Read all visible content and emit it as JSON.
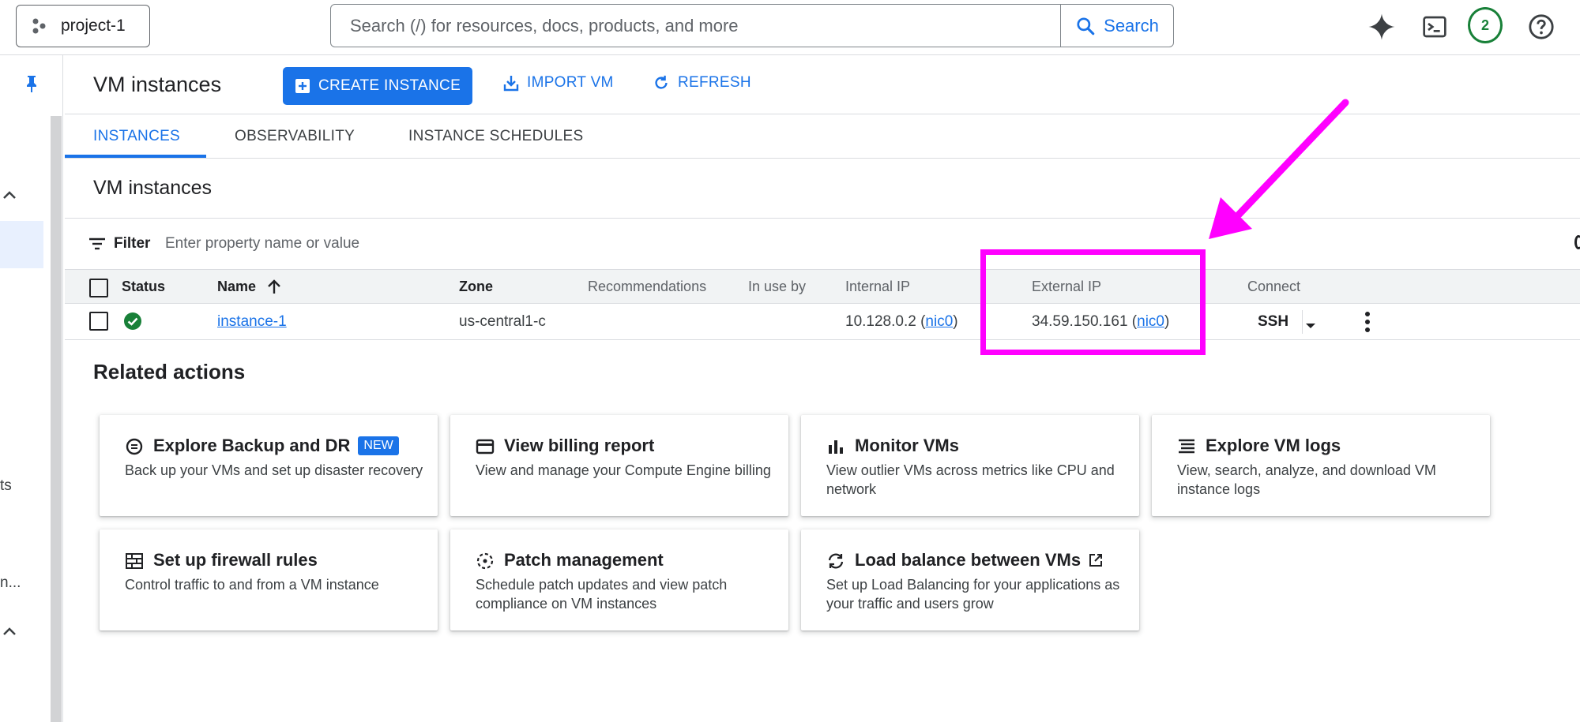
{
  "topbar": {
    "project_name": "project-1",
    "search_placeholder": "Search (/) for resources, docs, products, and more",
    "search_button": "Search",
    "notification_count": "2"
  },
  "left_rail": {
    "partial_label_1": "ts",
    "partial_label_2": "n..."
  },
  "header": {
    "title": "VM instances",
    "create_button": "CREATE INSTANCE",
    "import_button": "IMPORT VM",
    "refresh_button": "REFRESH"
  },
  "tabs": [
    {
      "label": "INSTANCES"
    },
    {
      "label": "OBSERVABILITY"
    },
    {
      "label": "INSTANCE SCHEDULES"
    }
  ],
  "section_title": "VM instances",
  "filter": {
    "label": "Filter",
    "placeholder": "Enter property name or value"
  },
  "table": {
    "columns": [
      "Status",
      "Name",
      "Zone",
      "Recommendations",
      "In use by",
      "Internal IP",
      "External IP",
      "Connect"
    ],
    "rows": [
      {
        "name": "instance-1",
        "zone": "us-central1-c",
        "internal_ip": "10.128.0.2",
        "internal_nic": "nic0",
        "external_ip": "34.59.150.161",
        "external_nic": "nic0",
        "connect": "SSH",
        "status": "running"
      }
    ]
  },
  "related": {
    "title": "Related actions",
    "cards": [
      {
        "title": "Explore Backup and DR",
        "badge": "NEW",
        "desc": "Back up your VMs and set up disaster recovery",
        "icon": "backup-icon"
      },
      {
        "title": "View billing report",
        "desc": "View and manage your Compute Engine billing",
        "icon": "billing-icon"
      },
      {
        "title": "Monitor VMs",
        "desc": "View outlier VMs across metrics like CPU and network",
        "icon": "bar-chart-icon"
      },
      {
        "title": "Explore VM logs",
        "desc": "View, search, analyze, and download VM instance logs",
        "icon": "logs-icon"
      },
      {
        "title": "Set up firewall rules",
        "desc": "Control traffic to and from a VM instance",
        "icon": "firewall-icon"
      },
      {
        "title": "Patch management",
        "desc": "Schedule patch updates and view patch compliance on VM instances",
        "icon": "patch-icon"
      },
      {
        "title": "Load balance between VMs",
        "desc": "Set up Load Balancing for your applications as your traffic and users grow",
        "icon": "load-balance-icon"
      }
    ]
  },
  "colors": {
    "accent": "#1a73e8",
    "status_ok": "#188038",
    "annotation": "#ff00ff"
  }
}
